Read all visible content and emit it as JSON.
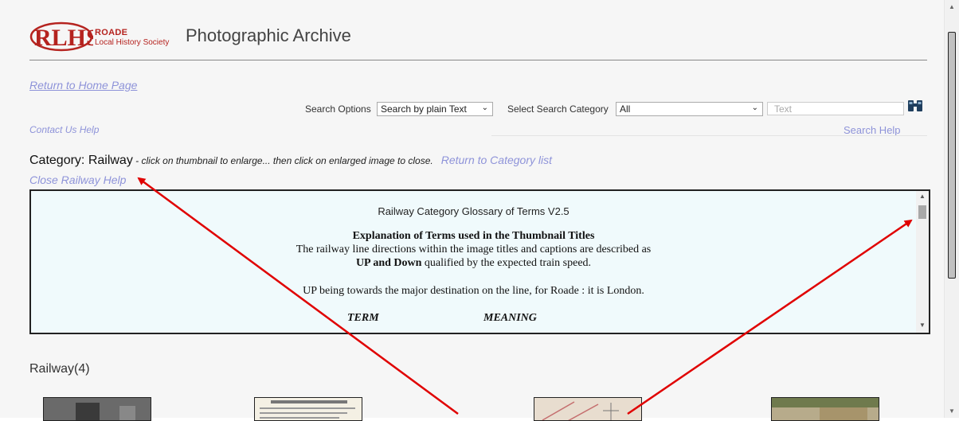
{
  "header": {
    "logo_name": "ROADE",
    "logo_sub": "Local History Society",
    "logo_mark": "RLHS",
    "title": "Photographic Archive"
  },
  "nav": {
    "home_link": "Return to Home Page",
    "contact_help": "Contact Us Help",
    "search_help": "Search Help"
  },
  "search": {
    "options_label": "Search Options",
    "options_selected": "Search by plain Text",
    "category_label": "Select Search Category",
    "category_selected": "All",
    "text_placeholder": "Text",
    "search_icon": "binoculars-icon"
  },
  "category": {
    "label": "Category: Railway",
    "note": " - click on thumbnail to enlarge... then click on enlarged image to close.",
    "return_link": "Return to Category list",
    "close_help": "Close Railway Help"
  },
  "glossary": {
    "title": "Railway Category Glossary of Terms V2.5",
    "heading": "Explanation of Terms used in the Thumbnail Titles",
    "line1": "The railway line directions within the image titles and captions are described as",
    "line2_bold": "UP and Down",
    "line2_rest": " qualified by the expected train speed.",
    "up_line": "UP being towards the major destination on the line, for Roade : it is London.",
    "col_term": "TERM",
    "col_meaning": "MEANING"
  },
  "section": {
    "title": "Railway(4)"
  },
  "colors": {
    "link": "#8e93d9",
    "logo_red": "#b5231f",
    "glossary_bg": "#f0fafc",
    "arrow": "#e00000"
  }
}
